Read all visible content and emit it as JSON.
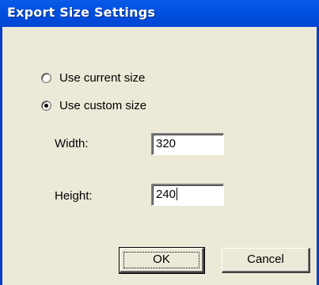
{
  "dialog": {
    "title": "Export Size Settings"
  },
  "options": [
    {
      "label": "Use current size",
      "checked": false
    },
    {
      "label": "Use custom size",
      "checked": true
    }
  ],
  "fields": {
    "width": {
      "label": "Width:",
      "value": "320"
    },
    "height": {
      "label": "Height:",
      "value": "240"
    }
  },
  "buttons": {
    "ok": "OK",
    "cancel": "Cancel"
  }
}
